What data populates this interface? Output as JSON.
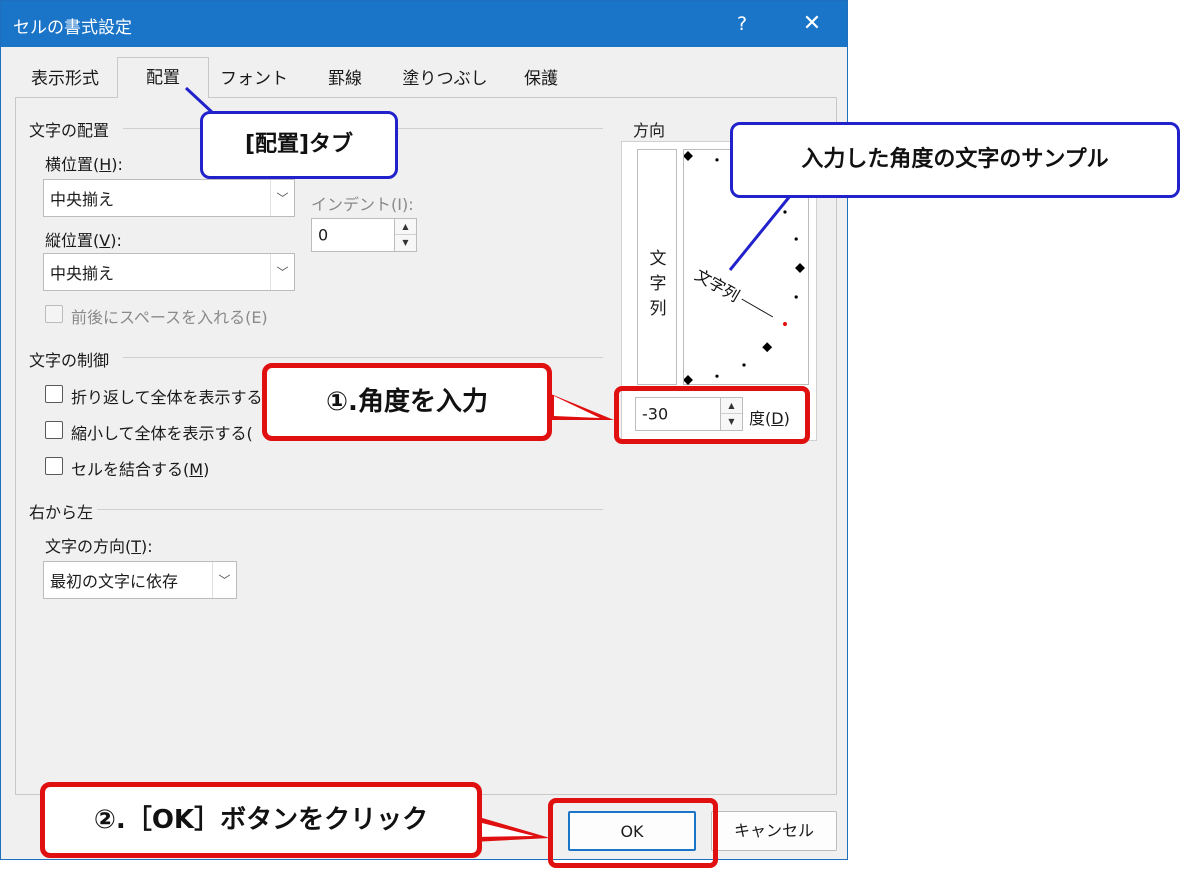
{
  "dialog": {
    "title": "セルの書式設定",
    "help": "?",
    "close": "✕"
  },
  "tabs": [
    {
      "label": "表示形式"
    },
    {
      "label": "配置"
    },
    {
      "label": "フォント"
    },
    {
      "label": "罫線"
    },
    {
      "label": "塗りつぶし"
    },
    {
      "label": "保護"
    }
  ],
  "text_alignment": {
    "group": "文字の配置",
    "horizontal_label": "横位置(H):",
    "horizontal_value": "中央揃え",
    "indent_label": "インデント(I):",
    "indent_value": "0",
    "vertical_label": "縦位置(V):",
    "vertical_value": "中央揃え",
    "distributed_label": "前後にスペースを入れる(E)"
  },
  "text_control": {
    "group": "文字の制御",
    "wrap_label": "折り返して全体を表示する",
    "shrink_label": "縮小して全体を表示する(",
    "merge_label": "セルを結合する(M)"
  },
  "rtl": {
    "group": "右から左",
    "direction_label": "文字の方向(T):",
    "direction_value": "最初の文字に依存"
  },
  "orientation": {
    "group": "方向",
    "vertical_text": [
      "文",
      "字",
      "列"
    ],
    "sample_text": "文字列",
    "degrees_value": "-30",
    "degrees_label": "度(D)",
    "angle": -30
  },
  "buttons": {
    "ok": "OK",
    "cancel": "キャンセル"
  },
  "annotations": {
    "tab_callout": "[配置]タブ",
    "sample_callout": "入力した角度の文字のサンプル",
    "step1": "①.角度を入力",
    "step2": "②.［OK］ボタンをクリック"
  },
  "colors": {
    "titlebar": "#1a74c8",
    "callout_blue": "#2222cc",
    "callout_red": "#e01010"
  }
}
